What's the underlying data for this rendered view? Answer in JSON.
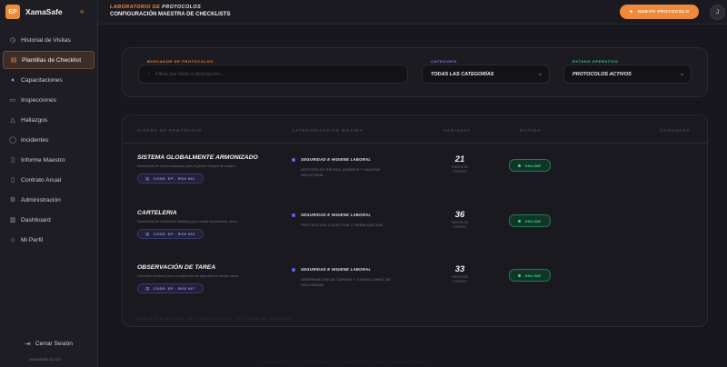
{
  "brand": {
    "logo": "EP",
    "name": "XamaSafe",
    "collapse_icon": "double-chevron-left-icon"
  },
  "sidebar": {
    "items": [
      {
        "label": "Historial de Visitas",
        "icon": "history-icon",
        "active": false
      },
      {
        "label": "Plantillas de Checklist",
        "icon": "checklist-icon",
        "active": true
      },
      {
        "label": "Capacitaciones",
        "icon": "graduation-cap-icon",
        "active": false
      },
      {
        "label": "Inspecciones",
        "icon": "clipboard-icon",
        "active": false
      },
      {
        "label": "Hallazgos",
        "icon": "warning-icon",
        "active": false
      },
      {
        "label": "Incidentes",
        "icon": "alert-circle-icon",
        "active": false
      },
      {
        "label": "Informe Maestro",
        "icon": "document-icon",
        "active": false
      },
      {
        "label": "Contrato Anual",
        "icon": "file-icon",
        "active": false
      },
      {
        "label": "Administración",
        "icon": "gear-icon",
        "active": false
      },
      {
        "label": "Dashboard",
        "icon": "chart-icon",
        "active": false
      },
      {
        "label": "Mi Perfil",
        "icon": "user-icon",
        "active": false
      }
    ],
    "logout_label": "Cerrar Sesión",
    "version": "XamaSafe v1.0.0"
  },
  "header": {
    "title_part_a": "LABORATORIO DE",
    "title_part_b": "PROTOCOLOS",
    "subtitle": "CONFIGURACIÓN MAESTRA DE CHECKLISTS",
    "new_button": "NUEVO PROTOCOLO",
    "avatar_initial": "J"
  },
  "filters": {
    "search_label": "BUSCADOR DE PROTOCOLOS",
    "search_placeholder": "Filtrar por título o descripción...",
    "category_label": "CATEGORÍA",
    "category_value": "TODAS LAS CATEGORÍAS",
    "status_label": "ESTADO OPERATIVO",
    "status_value": "PROTOCOLOS ACTIVOS"
  },
  "table": {
    "columns": [
      "DISEÑO DE PROTOCOLO",
      "CATEGORIZACIÓN MÁXIMA",
      "VARIANZA",
      "ESTADO",
      "COMANDOS"
    ],
    "rows": [
      {
        "name": "SISTEMA GLOBALMENTE ARMONIZADO",
        "description": "Instrumento de control avanzado para la gestión integral de sustanc...",
        "code": "CODE: EP - RG8 891",
        "category": "SEGURIDAD E HIGIENE LABORAL",
        "subcategory": "GESTIÓN DE RIESGO QUÍMICO Y HIGIENE INDUSTRIAL",
        "variance": "21",
        "variance_label": "PUNTOS DE CONTROL",
        "status": "ONLINE"
      },
      {
        "name": "CARTELERIA",
        "description": "Instrumento de verificación diseñado para auditar la presencia, ubica...",
        "code": "CODE: EP - RG8 993",
        "category": "SEGURIDAD E HIGIENE LABORAL",
        "subcategory": "PROTECCIÓN COLECTIVA Y SEÑALIZACIÓN",
        "variance": "36",
        "variance_label": "PUNTOS DE CONTROL",
        "status": "ONLINE"
      },
      {
        "name": "OBSERVACIÓN DE TAREA",
        "description": "Formulario dinámico para la inspección de seguridad en tiempo opera...",
        "code": "CODE: EP - RG8 997",
        "category": "SEGURIDAD E HIGIENE LABORAL",
        "subcategory": "OBSERVACIÓN DE TAREAS Y CONDICIONES DE SEGURIDAD",
        "variance": "33",
        "variance_label": "PUNTOS DE CONTROL",
        "status": "ONLINE"
      }
    ],
    "footer": "REGISTRO GLOBAL DE PROTOCOLOS · SISTEMA DE GESTIÓN"
  },
  "page_footer": "XAMASAFE · SISTEMA DE GESTIÓN DE SEGURIDAD",
  "colors": {
    "accent": "#ef8a3a",
    "status_online": "#3fe095",
    "code_badge": "#9c95f0"
  }
}
